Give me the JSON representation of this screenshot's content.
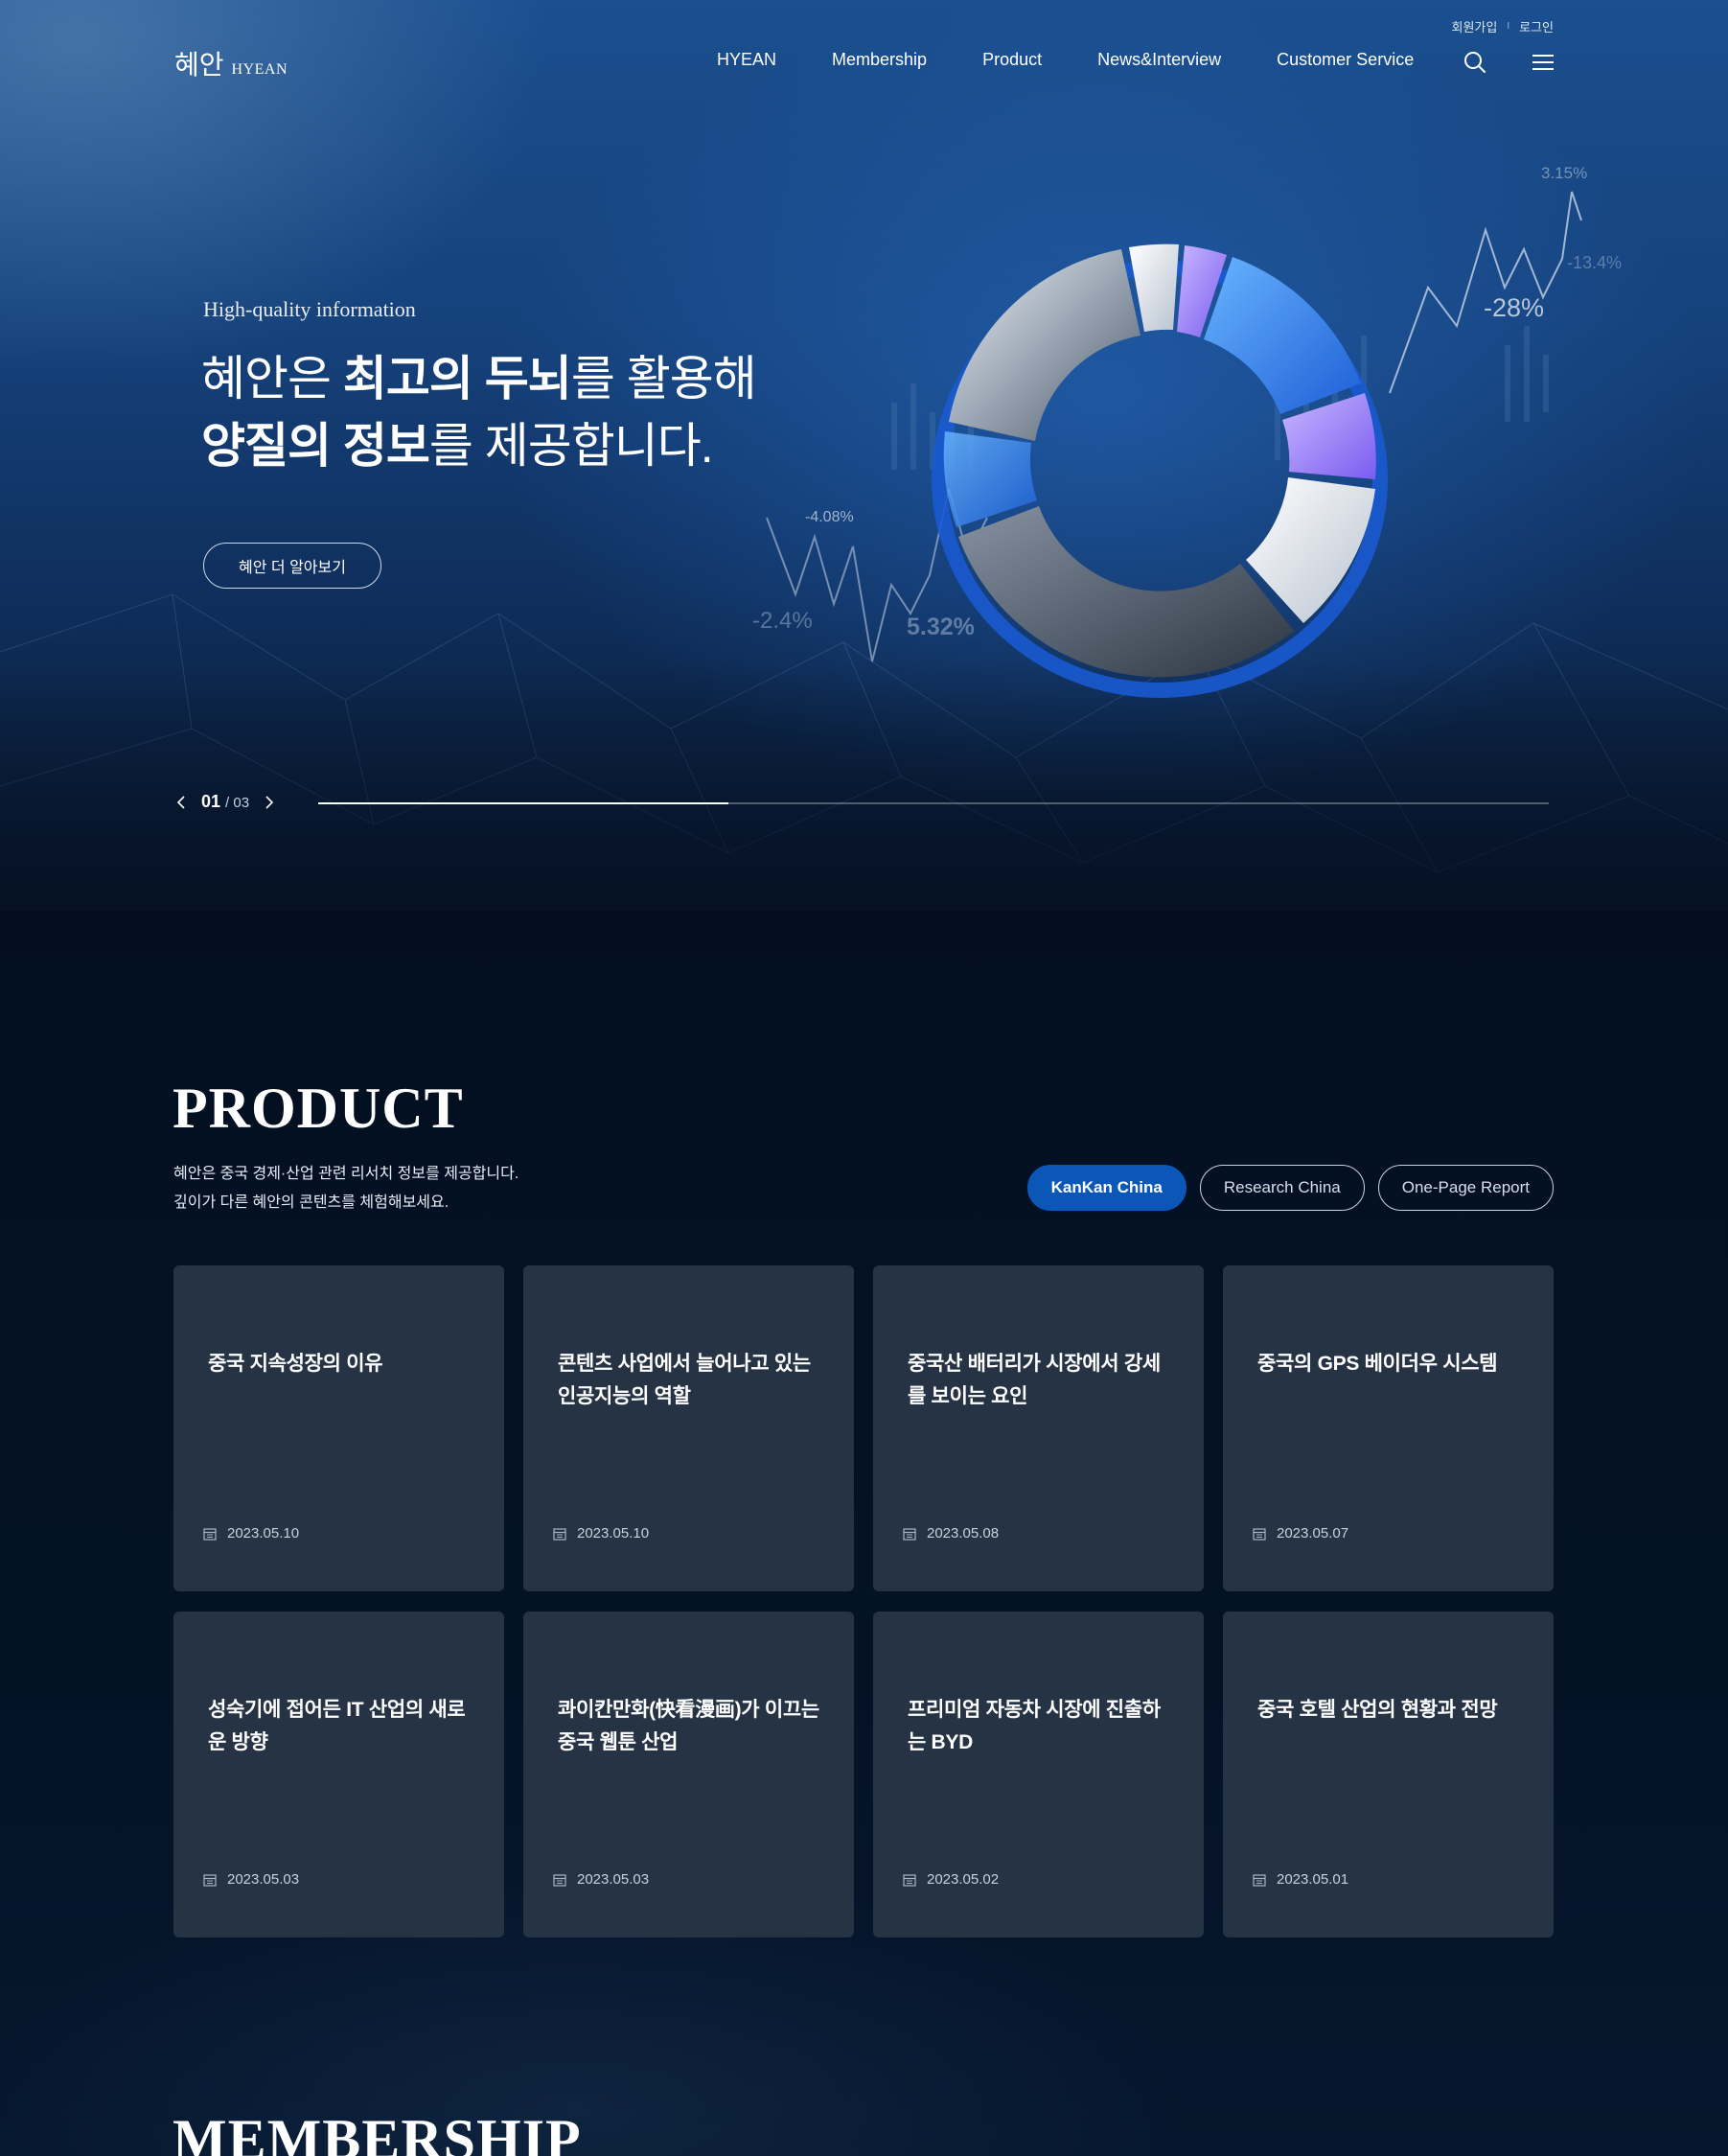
{
  "header": {
    "logo_ko": "혜안",
    "logo_en": "HYEAN",
    "util": {
      "signup": "회원가입",
      "sep": "I",
      "login": "로그인"
    },
    "nav": [
      "HYEAN",
      "Membership",
      "Product",
      "News&Interview",
      "Customer Service"
    ],
    "icons": {
      "search": "search-icon",
      "menu": "hamburger-menu-icon"
    }
  },
  "hero": {
    "eyebrow": "High-quality information",
    "title_line1_a": "혜안은 ",
    "title_line1_b": "최고의 두뇌",
    "title_line1_c": "를 활용해",
    "title_line2_a": "양질의 정보",
    "title_line2_b": "를 제공합니다.",
    "cta": "혜안 더 알아보기",
    "art_labels": [
      "3.15%",
      "-13.4%",
      "-28%",
      "-4.08%",
      "-2.4%",
      "5.32%"
    ],
    "slider": {
      "current": "01",
      "total": "/ 03",
      "progress": 0.333
    }
  },
  "product": {
    "title": "PRODUCT",
    "desc_line1": "혜안은 중국 경제·산업 관련 리서치 정보를 제공합니다.",
    "desc_line2": "깊이가 다른 혜안의 콘텐츠를 체험해보세요.",
    "tabs": [
      {
        "label": "KanKan China",
        "active": true
      },
      {
        "label": "Research China",
        "active": false
      },
      {
        "label": "One-Page Report",
        "active": false
      }
    ],
    "cards": [
      {
        "title": "중국 지속성장의 이유",
        "date": "2023.05.10"
      },
      {
        "title": "콘텐츠 사업에서 늘어나고 있는 인공지능의 역할",
        "date": "2023.05.10"
      },
      {
        "title": "중국산 배터리가 시장에서 강세를 보이는 요인",
        "date": "2023.05.08"
      },
      {
        "title": "중국의 GPS 베이더우 시스템",
        "date": "2023.05.07"
      },
      {
        "title": "성숙기에 접어든 IT 산업의 새로운 방향",
        "date": "2023.05.03"
      },
      {
        "title": "콰이칸만화(快看漫画)가 이끄는 중국 웹툰 산업",
        "date": "2023.05.03"
      },
      {
        "title": "프리미엄 자동차 시장에 진출하는 BYD",
        "date": "2023.05.02"
      },
      {
        "title": "중국 호텔 산업의 현황과 전망",
        "date": "2023.05.01"
      }
    ]
  },
  "membership": {
    "title": "MEMBERSHIP"
  }
}
